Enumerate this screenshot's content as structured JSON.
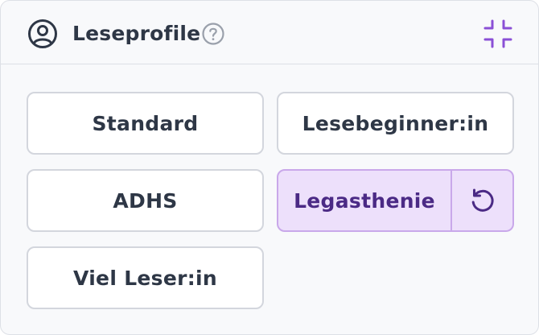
{
  "header": {
    "title": "Leseprofile",
    "icons": {
      "user": "user-circle-icon",
      "help": "question-circle-icon",
      "collapse": "collapse-arrows-icon"
    },
    "accent_color": "#8a4fd6"
  },
  "profiles": {
    "standard": "Standard",
    "lesebeginner": "Lesebeginner:in",
    "adhs": "ADHS",
    "legasthenie": "Legasthenie",
    "viel_leser": "Viel Leser:in"
  },
  "active_profile": "Legasthenie",
  "colors": {
    "active_background": "#ede0fb",
    "active_border": "#c9a8ea",
    "active_text": "#4b2a85",
    "text": "#2e3746"
  }
}
